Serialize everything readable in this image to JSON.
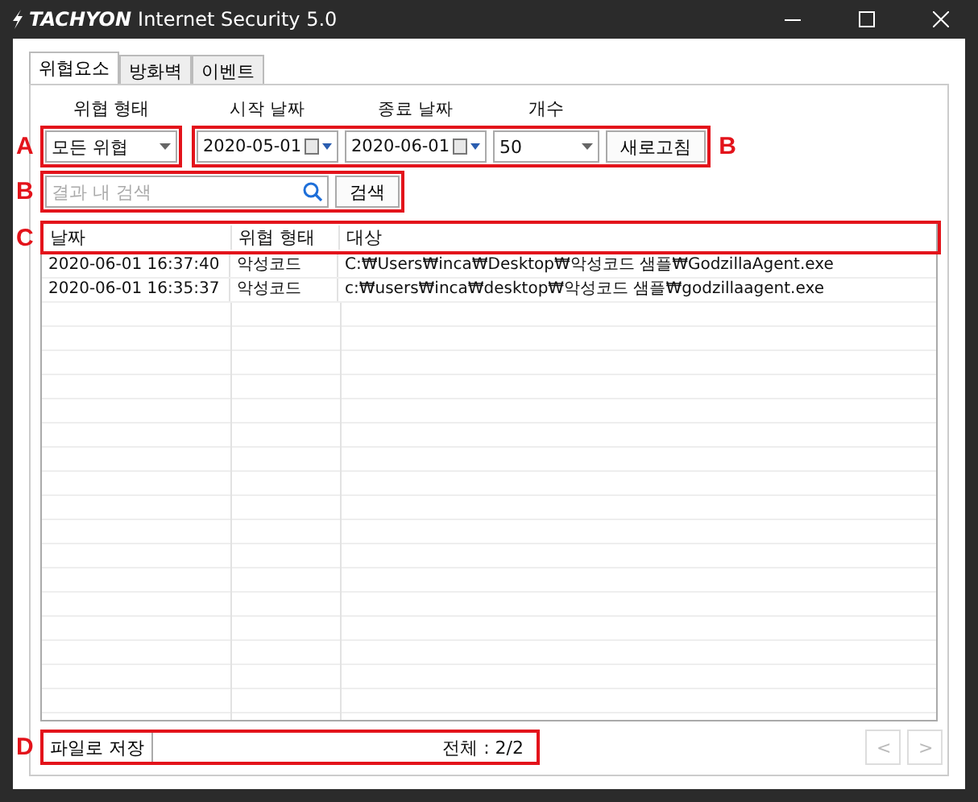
{
  "window": {
    "brand": "TACHYON",
    "title": "Internet Security 5.0"
  },
  "tabs": [
    {
      "label": "위협요소",
      "selected": true
    },
    {
      "label": "방화벽",
      "selected": false
    },
    {
      "label": "이벤트",
      "selected": false
    }
  ],
  "filters": {
    "threat_type": {
      "label": "위협 형태",
      "value": "모든 위협"
    },
    "start_date": {
      "label": "시작 날짜",
      "value": "2020-05-01"
    },
    "end_date": {
      "label": "종료 날짜",
      "value": "2020-06-01"
    },
    "count": {
      "label": "개수",
      "value": "50"
    },
    "refresh_button": "새로고침"
  },
  "search": {
    "placeholder": "결과 내 검색",
    "button": "검색"
  },
  "table": {
    "columns": [
      "날짜",
      "위협 형태",
      "대상"
    ],
    "rows": [
      [
        "2020-06-01 16:37:40",
        "악성코드",
        "C:₩Users₩inca₩Desktop₩악성코드 샘플₩GodzillaAgent.exe"
      ],
      [
        "2020-06-01 16:35:37",
        "악성코드",
        "c:₩users₩inca₩desktop₩악성코드 샘플₩godzillaagent.exe"
      ]
    ]
  },
  "footer": {
    "save_button": "파일로 저장",
    "total": "전체 : 2/2",
    "pager": [
      {
        "label": "<",
        "disabled": true
      },
      {
        "label": ">",
        "disabled": true
      }
    ]
  },
  "annotations": {
    "threat_type": "A",
    "filters": "B",
    "search": "B",
    "table_header": "C",
    "footer": "D"
  }
}
